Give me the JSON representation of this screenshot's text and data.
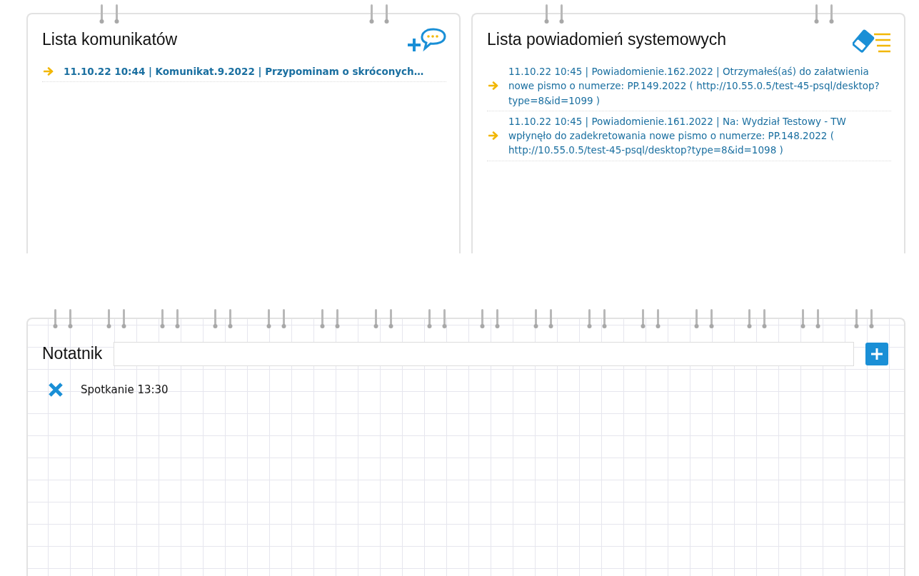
{
  "panels": [
    {
      "kind": "messages",
      "title": "Lista komunikatów",
      "items": [
        {
          "text": "11.10.22 10:44 | Komunikat.9.2022 | Przypominam o skróconych…"
        }
      ]
    },
    {
      "kind": "system",
      "title": "Lista powiadomień systemowych",
      "items": [
        {
          "text": "11.10.22 10:45 | Powiadomienie.162.2022 | Otrzymałeś(aś) do załatwienia nowe pismo o numerze: PP.149.2022 ( http://10.55.0.5/test-45-psql/desktop?type=8&id=1099 )"
        },
        {
          "text": "11.10.22 10:45 | Powiadomienie.161.2022 | Na: Wydział Testowy - TW wpłynęło do zadekretowania nowe pismo o numerze: PP.148.2022 ( http://10.55.0.5/test-45-psql/desktop?type=8&id=1098 )"
        }
      ]
    }
  ],
  "notebook": {
    "title": "Notatnik",
    "notes": [
      {
        "text": "Spotkanie 13:30"
      }
    ]
  }
}
